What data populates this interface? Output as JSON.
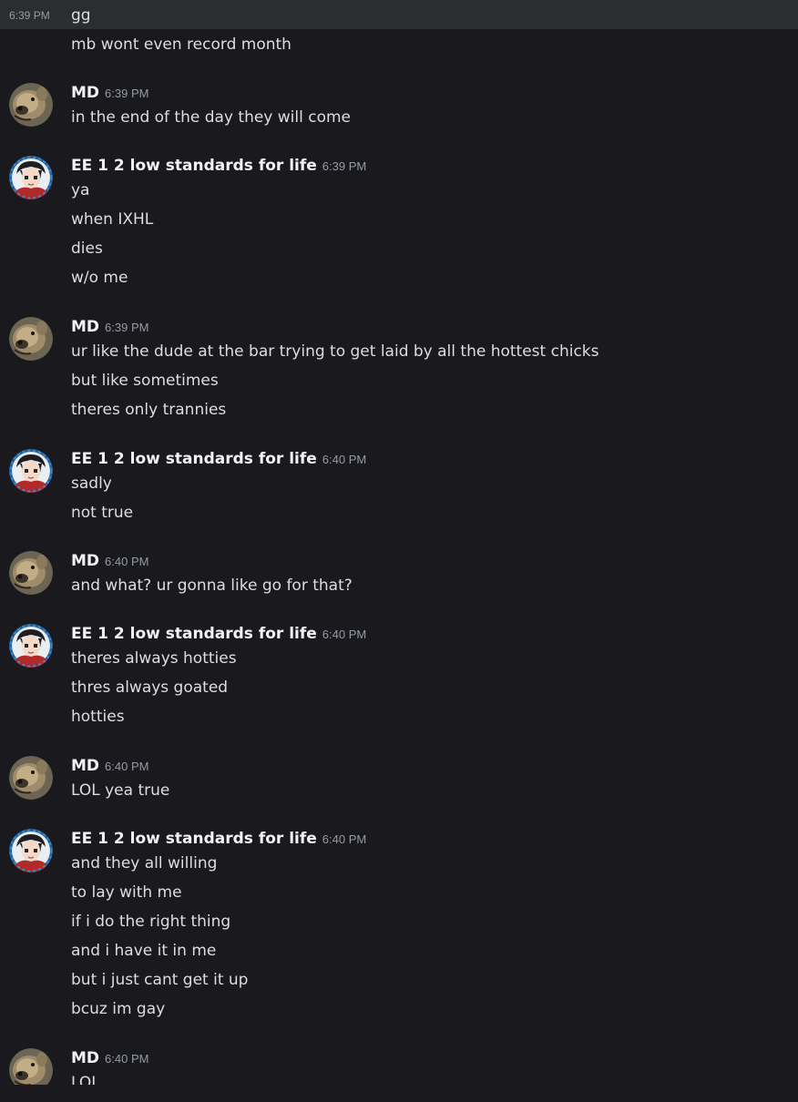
{
  "first": {
    "timestamp": "6:39 PM",
    "lines": [
      "gg",
      "mb wont even record month"
    ]
  },
  "groups": [
    {
      "author": "MD",
      "avatar": "dog-avatar",
      "timestamp": "6:39 PM",
      "lines": [
        "in the end of the day they will come"
      ]
    },
    {
      "author": "EE 1 2 low standards for life",
      "avatar": "anime-avatar",
      "timestamp": "6:39 PM",
      "lines": [
        "ya",
        "when IXHL",
        "dies",
        "w/o me"
      ]
    },
    {
      "author": "MD",
      "avatar": "dog-avatar",
      "timestamp": "6:39 PM",
      "lines": [
        "ur like the dude at the bar trying to get laid by all the hottest chicks",
        "but like sometimes",
        "theres only trannies"
      ]
    },
    {
      "author": "EE 1 2 low standards for life",
      "avatar": "anime-avatar",
      "timestamp": "6:40 PM",
      "lines": [
        "sadly",
        "not true"
      ]
    },
    {
      "author": "MD",
      "avatar": "dog-avatar",
      "timestamp": "6:40 PM",
      "lines": [
        "and what? ur gonna like go for that?"
      ]
    },
    {
      "author": "EE 1 2 low standards for life",
      "avatar": "anime-avatar",
      "timestamp": "6:40 PM",
      "lines": [
        "theres always hotties",
        "thres always goated",
        "hotties"
      ]
    },
    {
      "author": "MD",
      "avatar": "dog-avatar",
      "timestamp": "6:40 PM",
      "lines": [
        "LOL yea true"
      ]
    },
    {
      "author": "EE 1 2 low standards for life",
      "avatar": "anime-avatar",
      "timestamp": "6:40 PM",
      "lines": [
        "and they all willing",
        "to lay with me",
        "if i do the right thing",
        "and i have it in me",
        "but i just cant get it up",
        "bcuz im gay"
      ]
    },
    {
      "author": "MD",
      "avatar": "dog-avatar",
      "timestamp": "6:40 PM",
      "lines": [
        "LOL"
      ]
    }
  ],
  "colors": {
    "background": "#1a1a1e",
    "highlight_row": "#2b2d31",
    "text": "#dbdee1",
    "author": "#f2f3f5",
    "timestamp": "#949ba4"
  }
}
